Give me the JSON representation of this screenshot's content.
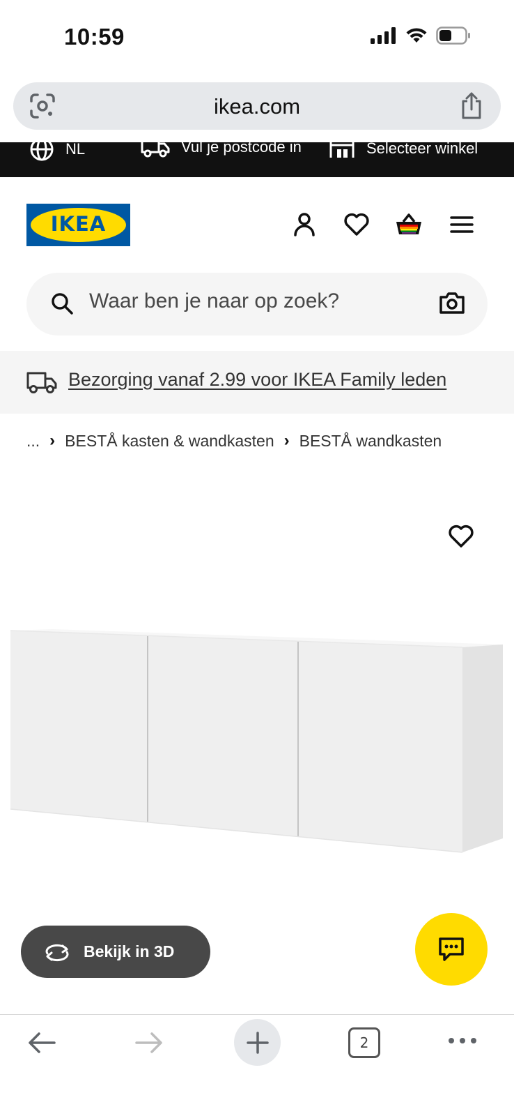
{
  "status_bar": {
    "time": "10:59"
  },
  "browser": {
    "url": "ikea.com",
    "tab_count": "2"
  },
  "top_strip": {
    "language": "NL",
    "postcode": "Vul je postcode in",
    "store": "Selecteer winkel"
  },
  "header": {
    "logo_text": "IKEA"
  },
  "search": {
    "placeholder": "Waar ben je naar op zoek?"
  },
  "delivery_banner": {
    "text": "Bezorging vanaf 2.99 voor IKEA Family leden"
  },
  "breadcrumb": {
    "ellipsis": "...",
    "items": [
      "BESTÅ kasten & wandkasten",
      "BESTÅ wandkasten"
    ]
  },
  "product": {
    "view_3d_label": "Bekijk in 3D"
  },
  "colors": {
    "ikea_blue": "#0058a3",
    "ikea_yellow": "#ffdb00",
    "strip_black": "#111111",
    "button_gray": "#484848"
  }
}
